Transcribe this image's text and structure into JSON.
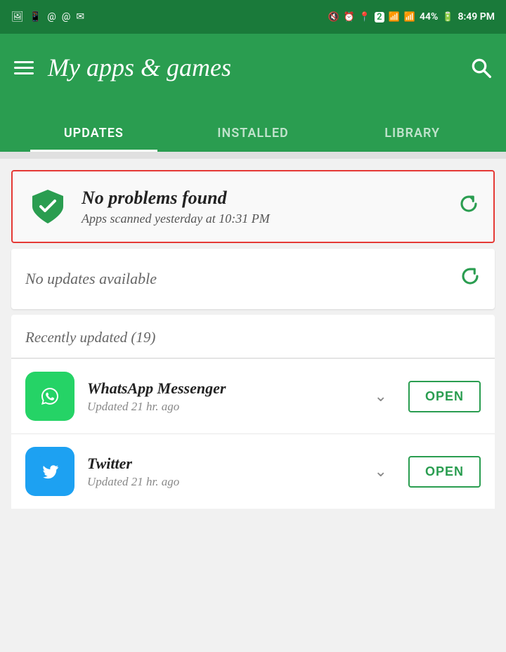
{
  "statusBar": {
    "leftIcons": [
      "image-icon",
      "tablet-icon",
      "at-icon",
      "at2-icon",
      "mail-icon"
    ],
    "rightText": "44% 8:49 PM",
    "batteryPercent": "44%",
    "time": "8:49 PM"
  },
  "header": {
    "title": "My apps & games",
    "hamburgerLabel": "Menu",
    "searchLabel": "Search"
  },
  "tabs": [
    {
      "label": "UPDATES",
      "active": true
    },
    {
      "label": "INSTALLED",
      "active": false
    },
    {
      "label": "LIBRARY",
      "active": false
    }
  ],
  "securityCard": {
    "title": "No problems found",
    "subtitle": "Apps scanned yesterday at 10:31 PM",
    "shieldColor": "#2a9d50",
    "refreshLabel": "Refresh"
  },
  "updatesCard": {
    "text": "No updates available",
    "refreshLabel": "Refresh"
  },
  "recentlyUpdated": {
    "label": "Recently updated (19)"
  },
  "apps": [
    {
      "name": "WhatsApp Messenger",
      "updated": "Updated 21 hr. ago",
      "iconType": "whatsapp",
      "openLabel": "OPEN"
    },
    {
      "name": "Twitter",
      "updated": "Updated 21 hr. ago",
      "iconType": "twitter",
      "openLabel": "OPEN"
    }
  ]
}
